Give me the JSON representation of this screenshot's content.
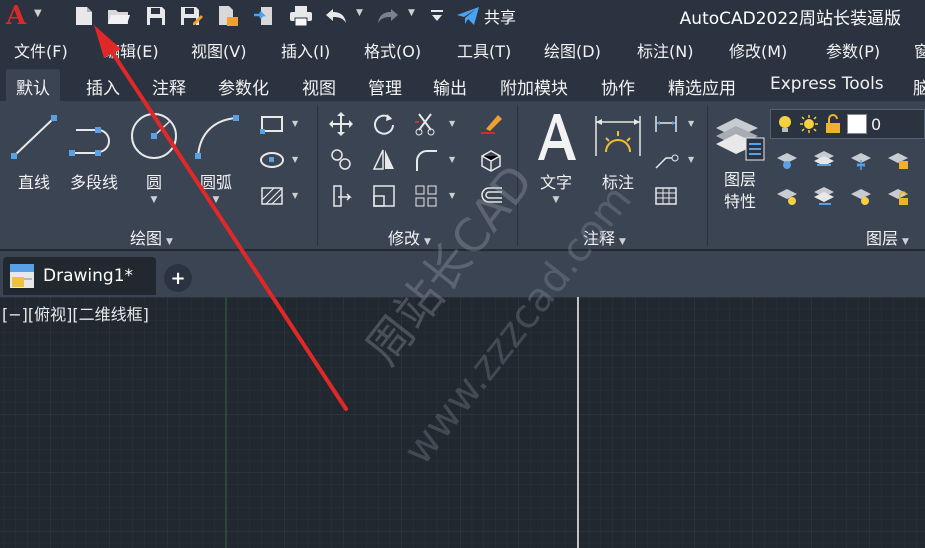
{
  "app": {
    "title": "AutoCAD2022周站长装逼版",
    "logo_letter": "A",
    "share_label": "共享"
  },
  "quick_access": [
    {
      "name": "new-file-icon"
    },
    {
      "name": "open-folder-icon"
    },
    {
      "name": "save-icon"
    },
    {
      "name": "save-as-icon"
    },
    {
      "name": "open-from-web-icon"
    },
    {
      "name": "publish-icon"
    },
    {
      "name": "print-icon"
    },
    {
      "name": "undo-icon"
    },
    {
      "name": "redo-icon"
    },
    {
      "name": "customize-toolbar-icon"
    },
    {
      "name": "share-plane-icon"
    }
  ],
  "menu": [
    "文件(F)",
    "编辑(E)",
    "视图(V)",
    "插入(I)",
    "格式(O)",
    "工具(T)",
    "绘图(D)",
    "标注(N)",
    "修改(M)",
    "参数(P)",
    "窗"
  ],
  "ribbon_tabs": [
    "默认",
    "插入",
    "注释",
    "参数化",
    "视图",
    "管理",
    "输出",
    "附加模块",
    "协作",
    "精选应用",
    "Express Tools",
    "脑"
  ],
  "active_tab": "默认",
  "draw_panel": {
    "label": "绘图",
    "tools": [
      "直线",
      "多段线",
      "圆",
      "圆弧"
    ]
  },
  "modify_panel": {
    "label": "修改"
  },
  "annotation_panel": {
    "label": "注释",
    "tools": [
      "文字",
      "标注"
    ]
  },
  "layers_panel": {
    "label": "图层",
    "tool": "图层\n特性",
    "tool_line1": "图层",
    "tool_line2": "特性",
    "current_layer": "0"
  },
  "document": {
    "tab_title": "Drawing1*",
    "add_tab": "+"
  },
  "viewport_label": "[−][俯视][二维线框]",
  "watermark": {
    "cn": "周站长CAD",
    "url": "www.zzzcad.com"
  },
  "colors": {
    "ui_dark": "#2b3340",
    "panel": "#3b4453",
    "canvas": "#212830",
    "logo_red": "#d82a2a",
    "arrow_red": "#e02828",
    "accent_blue": "#5aa0e6",
    "share_blue": "#4aa3f0",
    "green_axis": "#2e6b3a"
  }
}
